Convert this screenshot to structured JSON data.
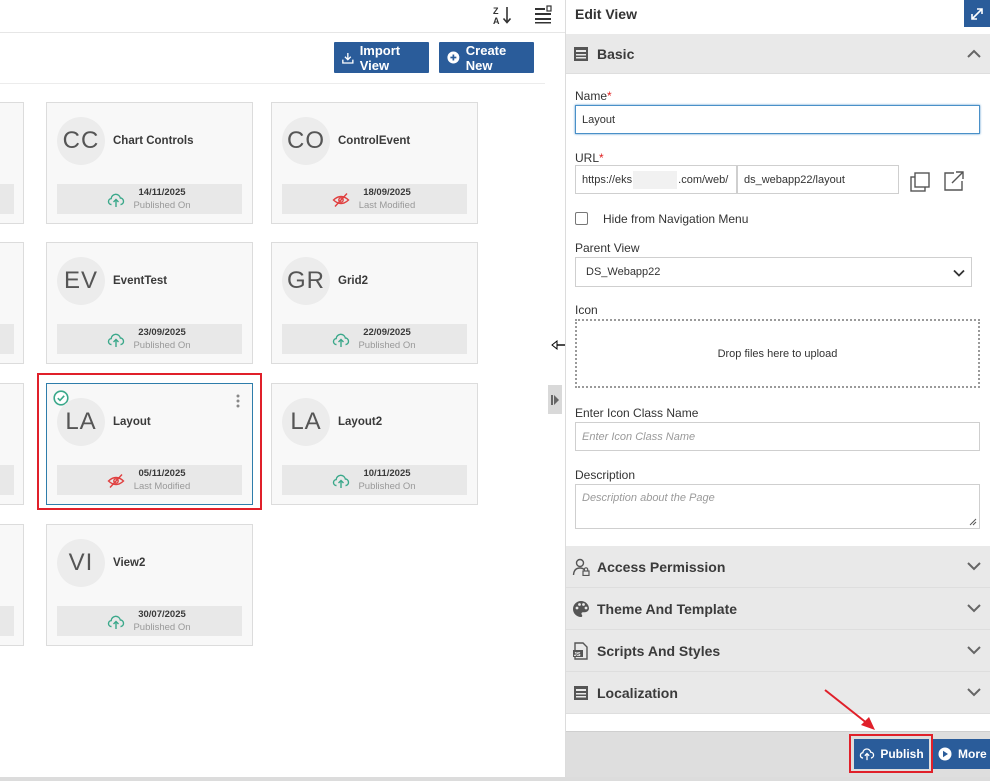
{
  "toolbar": {
    "sort_icon": "sort-za-icon",
    "list_icon": "list-settings-icon",
    "import_label": "Import View",
    "create_label": "Create New"
  },
  "cards": [
    {
      "initials": "CC",
      "name": "Chart Controls",
      "date": "14/11/2025",
      "status": "Published On",
      "icon": "cloud-upload-icon"
    },
    {
      "initials": "CO",
      "name": "ControlEvent",
      "date": "18/09/2025",
      "status": "Last Modified",
      "icon": "hidden-eye-icon"
    },
    {
      "initials": "EV",
      "name": "EventTest",
      "date": "23/09/2025",
      "status": "Published On",
      "icon": "cloud-upload-icon"
    },
    {
      "initials": "GR",
      "name": "Grid2",
      "date": "22/09/2025",
      "status": "Published On",
      "icon": "cloud-upload-icon"
    },
    {
      "initials": "LA",
      "name": "Layout",
      "date": "05/11/2025",
      "status": "Last Modified",
      "icon": "hidden-eye-icon",
      "selected": true
    },
    {
      "initials": "LA",
      "name": "Layout2",
      "date": "10/11/2025",
      "status": "Published On",
      "icon": "cloud-upload-icon"
    },
    {
      "initials": "VI",
      "name": "View2",
      "date": "30/07/2025",
      "status": "Published On",
      "icon": "cloud-upload-icon"
    }
  ],
  "panel": {
    "title": "Edit View",
    "sections": {
      "basic": "Basic",
      "access": "Access Permission",
      "theme": "Theme And Template",
      "scripts": "Scripts And Styles",
      "localization": "Localization"
    },
    "fields": {
      "name_label": "Name",
      "name_value": "Layout",
      "url_label": "URL",
      "url_prefix_start": "https://eks",
      "url_prefix_end": ".com/web/",
      "url_path": "ds_webapp22/layout",
      "hide_nav_label": "Hide from Navigation Menu",
      "parent_label": "Parent View",
      "parent_value": "DS_Webapp22",
      "icon_label": "Icon",
      "dropzone_text": "Drop files here to upload",
      "icon_class_label": "Enter Icon Class Name",
      "icon_class_placeholder": "Enter Icon Class Name",
      "description_label": "Description",
      "description_placeholder": "Description about the Page"
    },
    "required_mark": "*",
    "footer": {
      "publish_label": "Publish",
      "more_label": "More"
    }
  },
  "colors": {
    "brand_blue": "#2a5c9a",
    "highlight_red": "#e0202a",
    "published_green": "#3aa88a",
    "modified_red": "#e04040"
  }
}
